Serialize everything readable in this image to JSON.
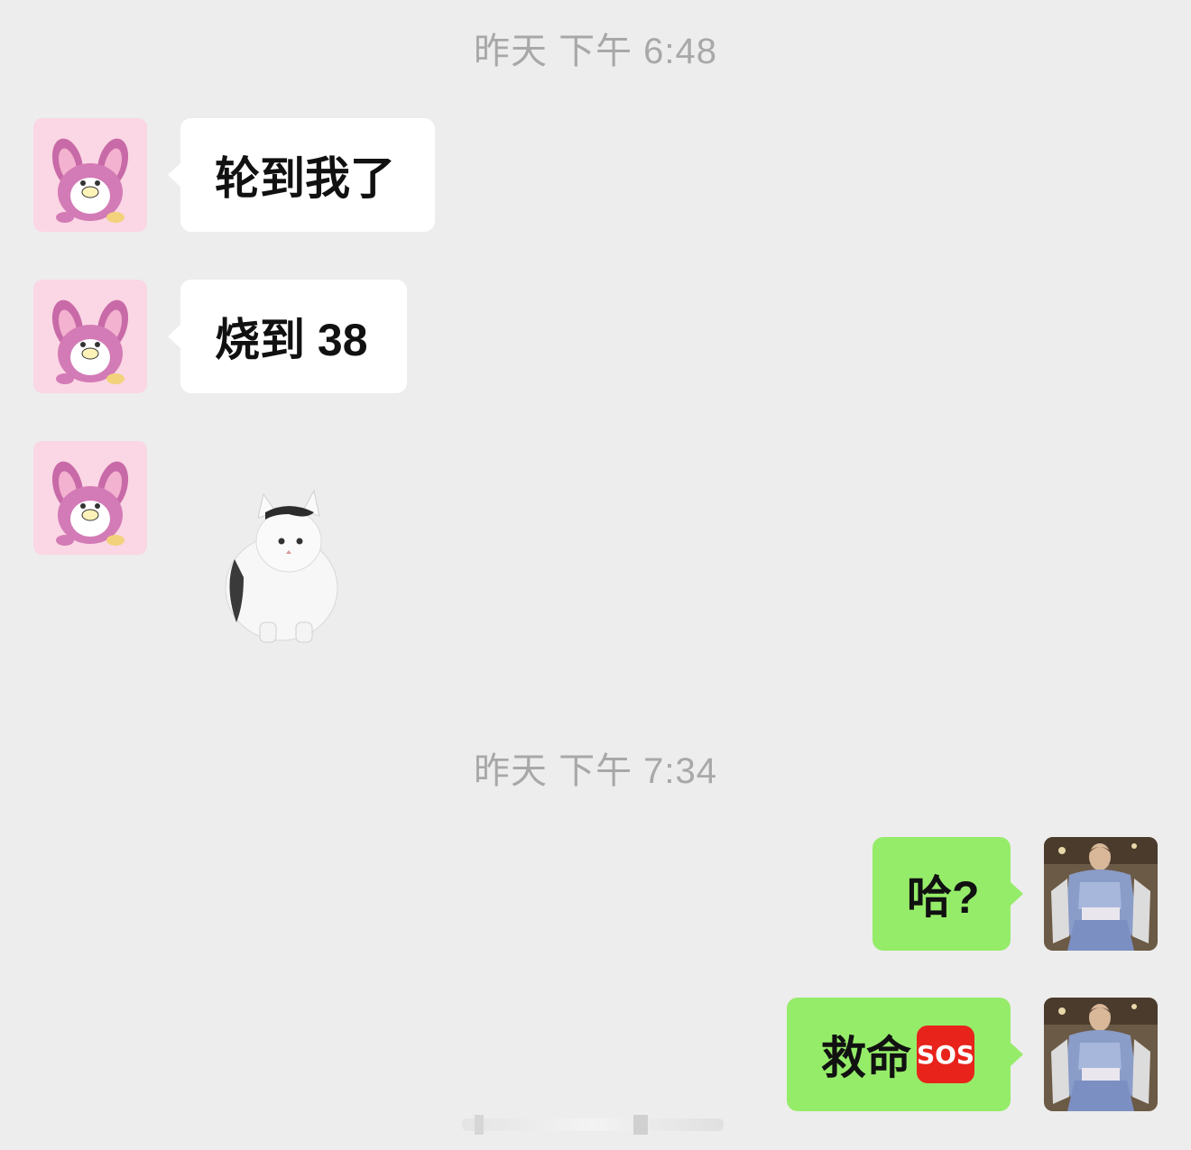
{
  "timestamps": [
    "昨天 下午 6:48",
    "昨天 下午 7:34"
  ],
  "messages": [
    {
      "side": "left",
      "text": "轮到我了",
      "avatar": "pink-stitch-avatar"
    },
    {
      "side": "left",
      "text": "烧到 38",
      "avatar": "pink-stitch-avatar"
    },
    {
      "side": "left",
      "sticker": "white-cat-sticker",
      "avatar": "pink-stitch-avatar"
    },
    {
      "side": "right",
      "text": "哈?",
      "avatar": "runway-model-avatar"
    },
    {
      "side": "right",
      "text": "救命",
      "badge": "SOS",
      "avatar": "runway-model-avatar"
    }
  ],
  "colors": {
    "background": "#ededed",
    "left_bubble": "#ffffff",
    "right_bubble": "#95ec69",
    "timestamp": "#a8a8a8",
    "sos": "#e8231c"
  }
}
